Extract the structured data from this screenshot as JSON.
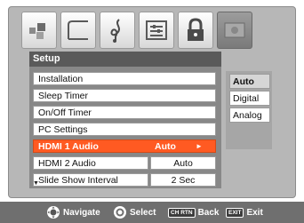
{
  "icons": [
    {
      "name": "picture-icon"
    },
    {
      "name": "screen-icon"
    },
    {
      "name": "audio-icon"
    },
    {
      "name": "preferences-icon"
    },
    {
      "name": "lock-icon"
    },
    {
      "name": "setup-icon",
      "active": true
    }
  ],
  "setup": {
    "title": "Setup",
    "items": [
      {
        "label": "Installation"
      },
      {
        "label": "Sleep Timer"
      },
      {
        "label": "On/Off Timer"
      },
      {
        "label": "PC Settings"
      },
      {
        "label": "HDMI 1 Audio",
        "value": "Auto",
        "selected": true
      },
      {
        "label": "HDMI 2 Audio",
        "value": "Auto"
      },
      {
        "label": "Slide Show Interval",
        "value": "2 Sec"
      }
    ]
  },
  "options": {
    "items": [
      "Auto",
      "Digital",
      "Analog"
    ],
    "selected": "Auto"
  },
  "navbar": {
    "navigate": "Navigate",
    "select": "Select",
    "back_chip": "CH RTN",
    "back": "Back",
    "exit_chip": "EXIT",
    "exit": "Exit"
  },
  "colors": {
    "highlight": "#ff5a22",
    "frame": "#b7b7b7",
    "header": "#5a5a5a"
  }
}
